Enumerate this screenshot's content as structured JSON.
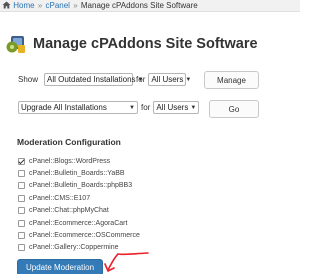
{
  "breadcrumb": {
    "home": "Home",
    "cpanel": "cPanel",
    "current": "Manage cPAddons Site Software",
    "separator": "»"
  },
  "page": {
    "title": "Manage cPAddons Site Software"
  },
  "show_row": {
    "show_label": "Show",
    "filter_value": "All Outdated Installations",
    "for_label": "for",
    "user_value": "All Users",
    "manage_label": "Manage"
  },
  "action_row": {
    "action_value": "Upgrade All Installations",
    "for_label": "for",
    "user_value": "All Users",
    "go_label": "Go"
  },
  "moderation": {
    "title": "Moderation Configuration",
    "items": [
      {
        "label": "cPanel::Blogs::WordPress",
        "checked": true
      },
      {
        "label": "cPanel::Bulletin_Boards::YaBB",
        "checked": false
      },
      {
        "label": "cPanel::Bulletin_Boards::phpBB3",
        "checked": false
      },
      {
        "label": "cPanel::CMS::E107",
        "checked": false
      },
      {
        "label": "cPanel::Chat::phpMyChat",
        "checked": false
      },
      {
        "label": "cPanel::Ecommerce::AgoraCart",
        "checked": false
      },
      {
        "label": "cPanel::Ecommerce::OSCommerce",
        "checked": false
      },
      {
        "label": "cPanel::Gallery::Coppermine",
        "checked": false
      }
    ],
    "update_label": "Update Moderation"
  },
  "colors": {
    "primary": "#337ab7",
    "link": "#2a73b3",
    "annotation": "#e8212b"
  }
}
